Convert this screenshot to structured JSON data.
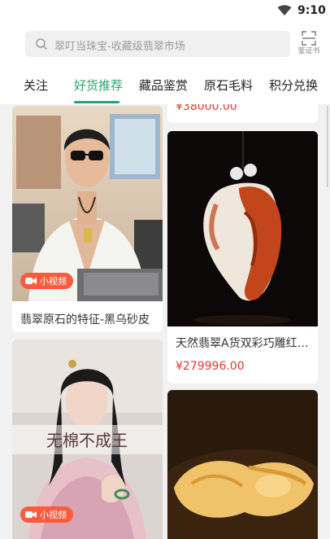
{
  "status": {
    "time": "9:10"
  },
  "search": {
    "placeholder": "翠叮当珠宝-收藏级翡翠市场",
    "scan_label": "鉴证书"
  },
  "tabs": [
    "关注",
    "好货推荐",
    "藏品鉴赏",
    "原石毛料",
    "积分兑换"
  ],
  "feed": {
    "left": [
      {
        "title": "翡翠原石的特征-黑乌砂皮",
        "badge": "小视频"
      },
      {
        "badge": "小视频",
        "overlay_text": "无棉不成王"
      }
    ],
    "right": [
      {
        "price": "¥38000.00"
      },
      {
        "title": "天然翡翠A货双彩巧雕红翡…",
        "price": "¥279996.00"
      },
      {}
    ]
  },
  "colors": {
    "accent": "#2aa36f",
    "price": "#e53935",
    "badge": "#ff5a3c"
  }
}
